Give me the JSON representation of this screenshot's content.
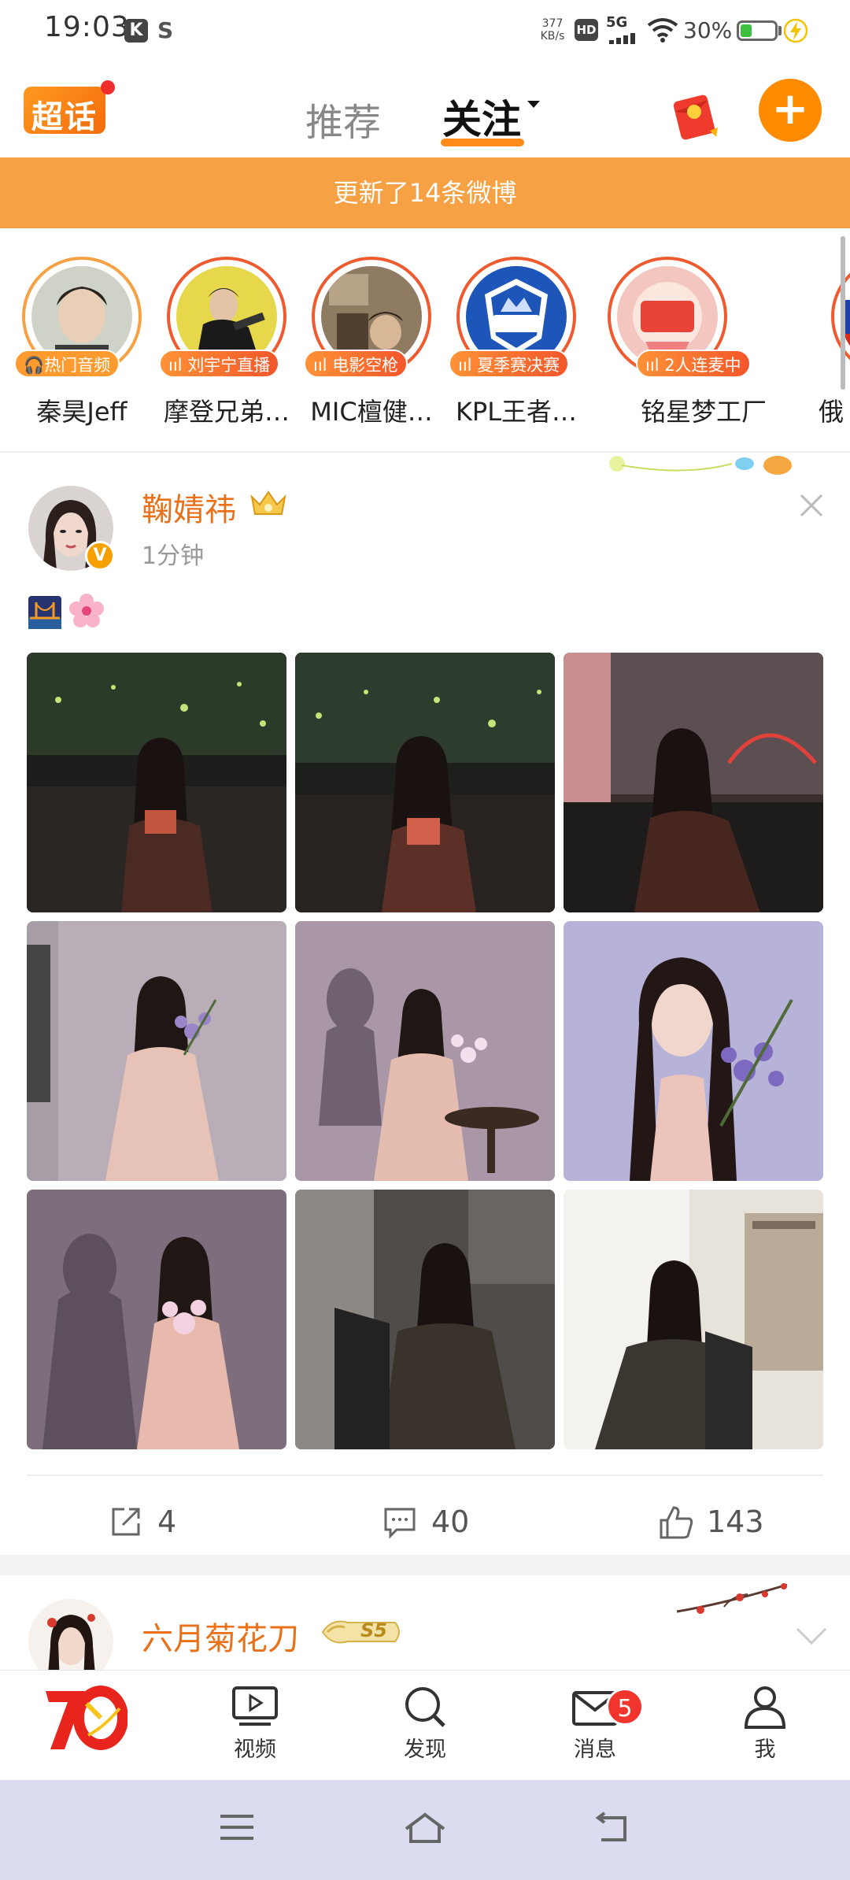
{
  "status_bar": {
    "time": "19:03",
    "app_icon_1": "K",
    "app_icon_2": "S",
    "net_speed_value": "377",
    "net_speed_unit": "KB/s",
    "hd": "HD",
    "network": "5G",
    "battery_percent": "30%",
    "battery_level": 0.3,
    "icons": [
      "signal-icon",
      "wifi-icon",
      "battery-icon",
      "charging-icon"
    ]
  },
  "header": {
    "logo_text": "超话",
    "tabs": [
      {
        "label": "推荐",
        "active": false
      },
      {
        "label": "关注",
        "active": true
      }
    ],
    "accent_color": "#ff8c00",
    "plus_label": "+"
  },
  "banner": {
    "text": "更新了14条微博",
    "color": "#f7a145"
  },
  "stories": [
    {
      "name": "秦昊Jeff",
      "tag": "热门音频",
      "tag_icon": "headphones-icon"
    },
    {
      "name": "摩登兄弟…",
      "tag": "刘宇宁直播",
      "tag_icon": "audio-bars-icon"
    },
    {
      "name": "MIC檀健…",
      "tag": "电影空枪",
      "tag_icon": "audio-bars-icon"
    },
    {
      "name": "KPL王者…",
      "tag": "夏季赛决赛",
      "tag_icon": "audio-bars-icon"
    },
    {
      "name": "铭星梦工厂",
      "tag": "2人连麦中",
      "tag_icon": "audio-bars-icon"
    },
    {
      "name": "俄",
      "tag": "",
      "tag_icon": ""
    }
  ],
  "post": {
    "author": "鞠婧祎",
    "verified_badge": "V",
    "time": "1分钟",
    "emoji": [
      "bridge-night-emoji",
      "cherry-blossom-emoji"
    ],
    "image_count": 9,
    "actions": {
      "repost": "4",
      "comment": "40",
      "like": "143"
    }
  },
  "post2": {
    "author": "六月菊花刀",
    "level_badge": "S5"
  },
  "bottom_nav": {
    "items": [
      {
        "label": "",
        "icon": "home-70-logo-icon"
      },
      {
        "label": "视频",
        "icon": "video-icon"
      },
      {
        "label": "发现",
        "icon": "search-icon"
      },
      {
        "label": "消息",
        "icon": "mail-icon",
        "badge": "5"
      },
      {
        "label": "我",
        "icon": "person-icon"
      }
    ]
  }
}
